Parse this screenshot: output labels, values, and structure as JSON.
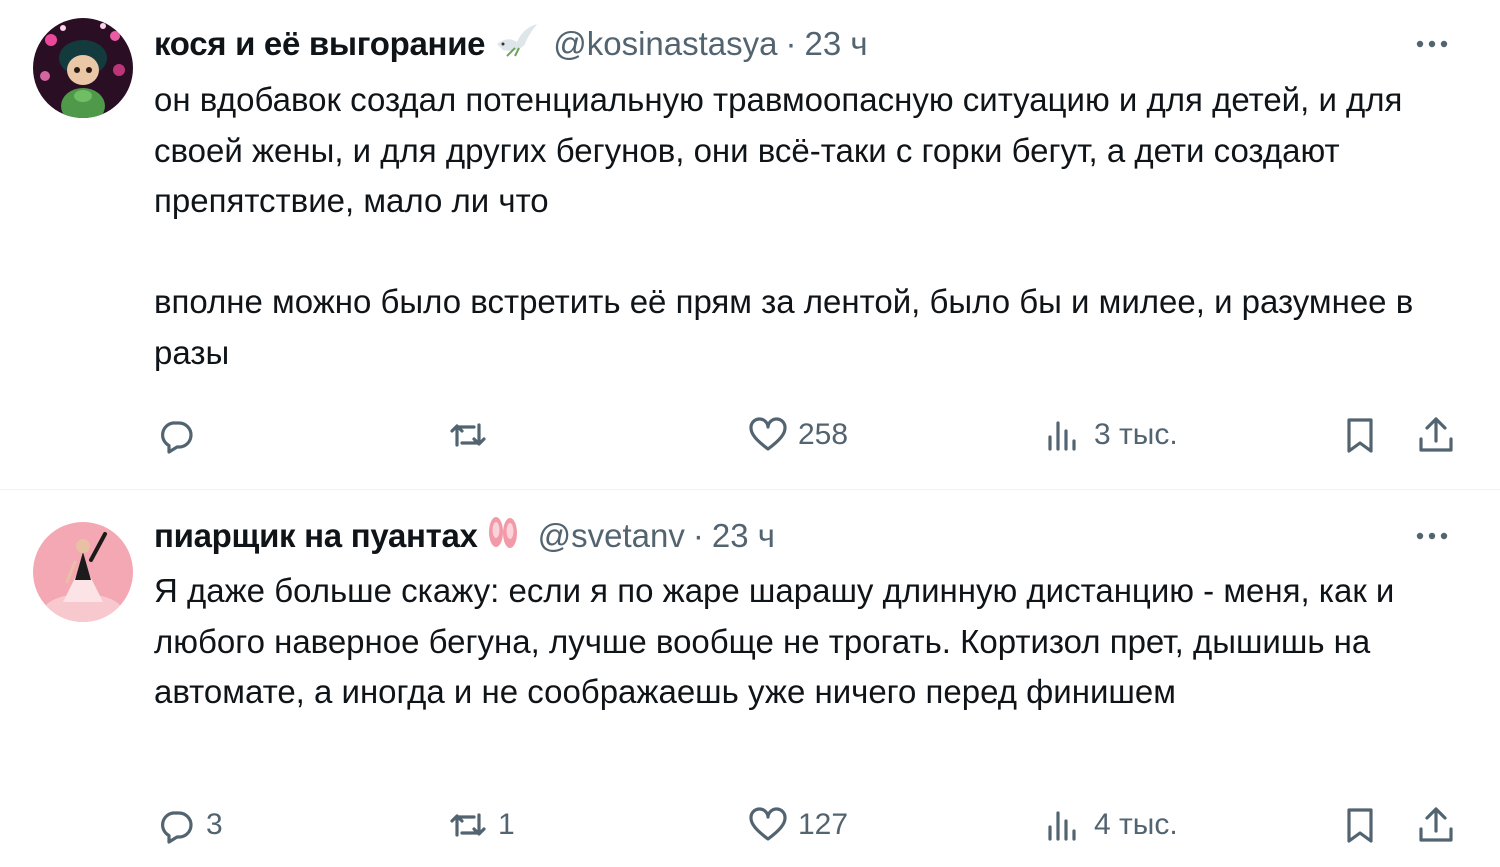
{
  "colors": {
    "text": "#0f1419",
    "secondary": "#536471",
    "divider": "#eff3f4"
  },
  "tweets": [
    {
      "author_name": "кося и её выгорание",
      "name_emoji": "dove-emoji",
      "handle": "@kosinastasya",
      "separator": "·",
      "time": "23 ч",
      "paragraphs": [
        "он вдобавок создал потенциальную травмоопасную ситуацию и для детей, и для своей жены, и для других бегунов, они всё-таки с горки бегут, а дети создают препятствие, мало ли что",
        "вполне можно было встретить её прям за лентой, было бы и милее, и разумнее в разы"
      ],
      "replies": "",
      "reposts": "",
      "likes": "258",
      "views": "3 тыс."
    },
    {
      "author_name": "пиарщик на пуантах",
      "name_emoji": "ballet-shoes-emoji",
      "handle": "@svetanv",
      "separator": "·",
      "time": "23 ч",
      "paragraphs": [
        "Я даже больше скажу: если я по жаре шарашу длинную дистанцию - меня, как и любого наверное бегуна, лучше вообще не трогать. Кортизол прет, дышишь на автомате, а иногда и не соображаешь уже ничего перед финишем"
      ],
      "replies": "3",
      "reposts": "1",
      "likes": "127",
      "views": "4 тыс."
    }
  ]
}
